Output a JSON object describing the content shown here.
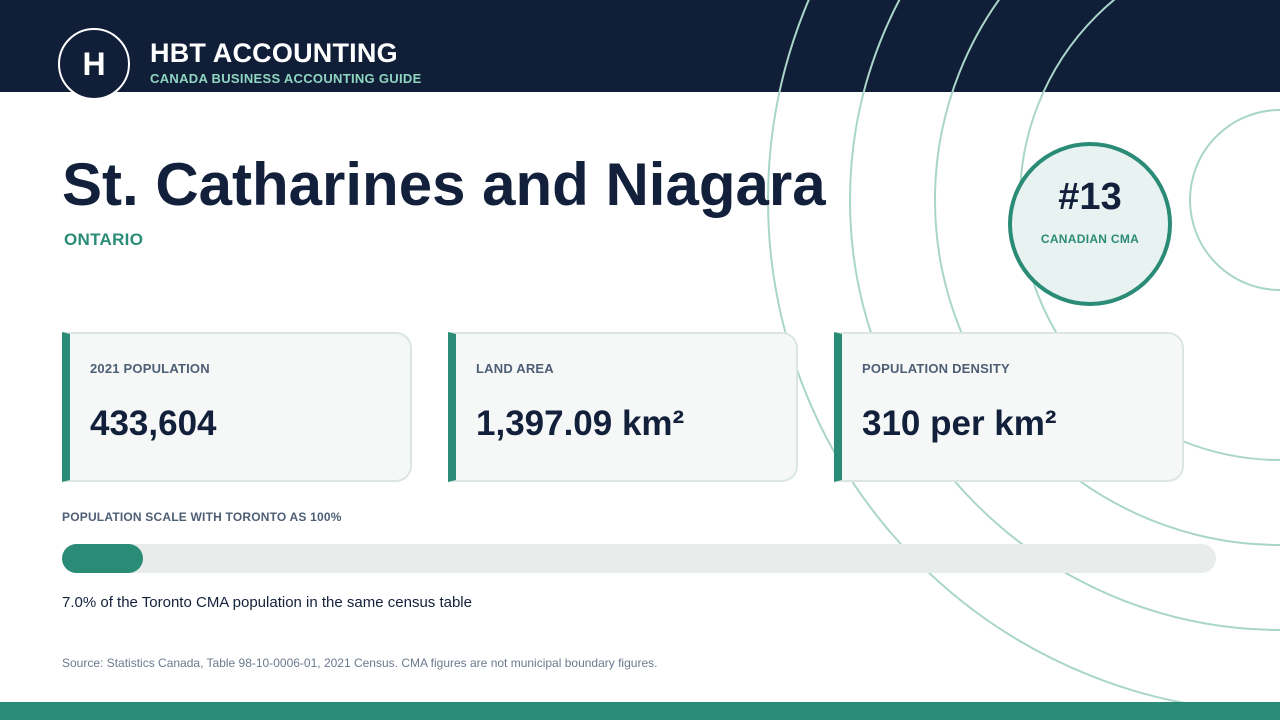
{
  "brand": {
    "logo_letter": "H",
    "title": "HBT ACCOUNTING",
    "subtitle": "CANADA BUSINESS ACCOUNTING GUIDE"
  },
  "city": {
    "name": "St. Catharines and Niagara",
    "province": "ONTARIO"
  },
  "rank": {
    "value": "#13",
    "label": "CANADIAN CMA"
  },
  "stats": [
    {
      "label": "2021 POPULATION",
      "value": "433,604"
    },
    {
      "label": "LAND AREA",
      "value": "1,397.09 km²"
    },
    {
      "label": "POPULATION DENSITY",
      "value": "310 per km²"
    }
  ],
  "scale": {
    "label": "POPULATION SCALE WITH TORONTO AS 100%",
    "percent": 7.0,
    "note": "7.0% of the Toronto CMA population in the same census table"
  },
  "source": "Source: Statistics Canada, Table 98-10-0006-01, 2021 Census. CMA figures are not municipal boundary figures.",
  "colors": {
    "navy": "#111e38",
    "accent": "#2a8c76",
    "accent_light": "#8fd6c1",
    "ring": "#a9d6c9"
  }
}
